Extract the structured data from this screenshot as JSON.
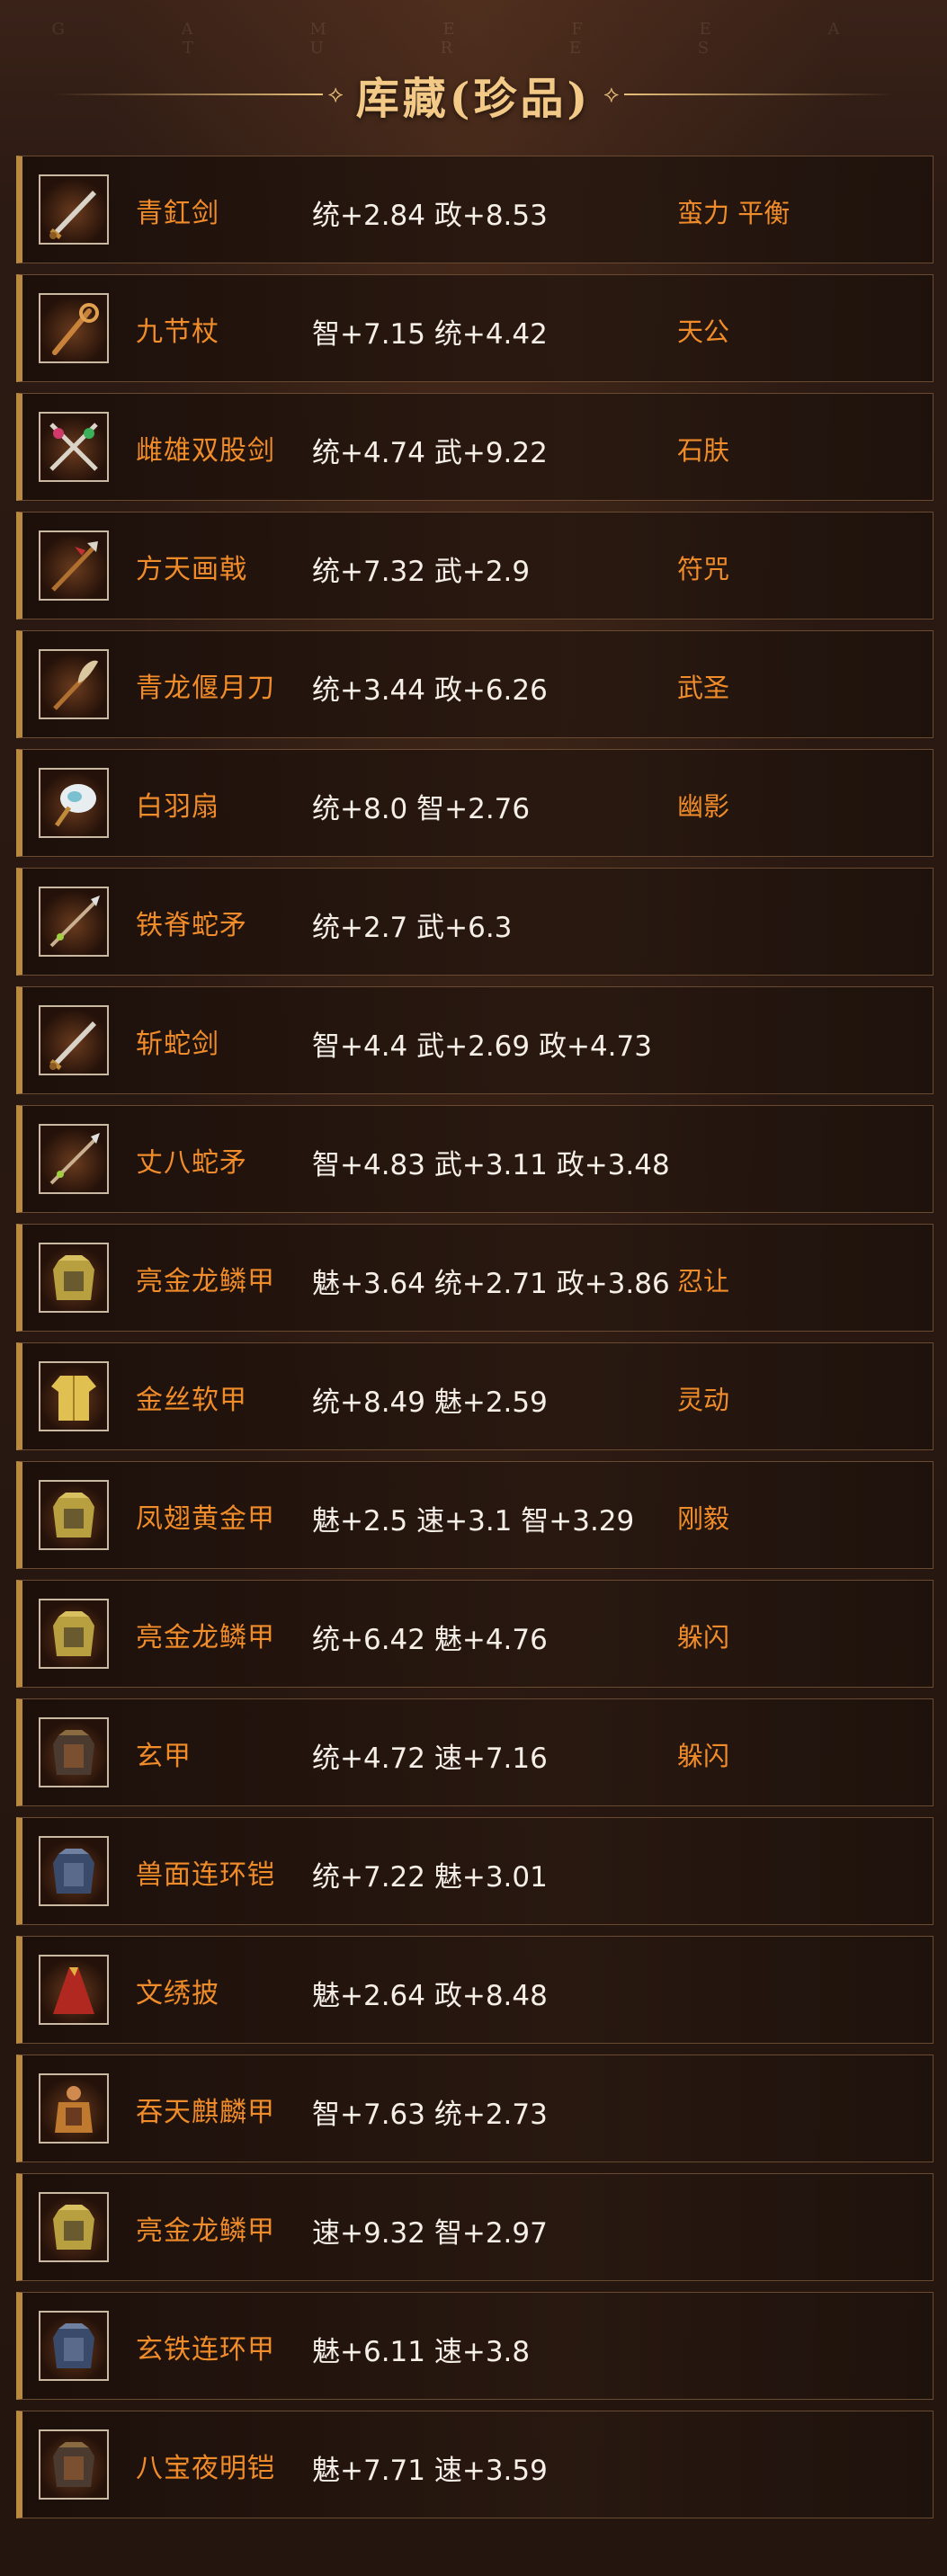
{
  "header": {
    "watermark": "G A M E   F E A T U R E S",
    "title": "库藏(珍品)",
    "ornament_left": "⟡",
    "ornament_right": "⟡"
  },
  "colors": {
    "name": "#f08c2a",
    "stats": "#f5efe8",
    "skill": "#f08c2a",
    "row_accent": "#b8893f",
    "title": "#f2c986"
  },
  "items": [
    {
      "name": "青釭剑",
      "stats": "统+2.84 政+8.53",
      "skill": "蛮力 平衡",
      "icon": "sword-icon"
    },
    {
      "name": "九节杖",
      "stats": "智+7.15 统+4.42",
      "skill": "天公",
      "icon": "staff-icon"
    },
    {
      "name": "雌雄双股剑",
      "stats": "统+4.74 武+9.22",
      "skill": "石肤",
      "icon": "twin-swords-icon"
    },
    {
      "name": "方天画戟",
      "stats": "统+7.32 武+2.9",
      "skill": "符咒",
      "icon": "halberd-icon"
    },
    {
      "name": "青龙偃月刀",
      "stats": "统+3.44 政+6.26",
      "skill": "武圣",
      "icon": "glaive-icon"
    },
    {
      "name": "白羽扇",
      "stats": "统+8.0 智+2.76",
      "skill": "幽影",
      "icon": "feather-fan-icon"
    },
    {
      "name": "铁脊蛇矛",
      "stats": "统+2.7 武+6.3",
      "skill": "",
      "icon": "spear-icon"
    },
    {
      "name": "斩蛇剑",
      "stats": "智+4.4 武+2.69 政+4.73",
      "skill": "",
      "icon": "sword-icon"
    },
    {
      "name": "丈八蛇矛",
      "stats": "智+4.83 武+3.11 政+3.48",
      "skill": "",
      "icon": "spear-icon"
    },
    {
      "name": "亮金龙鳞甲",
      "stats": "魅+3.64 统+2.71 政+3.86",
      "skill": "忍让",
      "icon": "armor-icon"
    },
    {
      "name": "金丝软甲",
      "stats": "统+8.49 魅+2.59",
      "skill": "灵动",
      "icon": "robe-icon"
    },
    {
      "name": "凤翅黄金甲",
      "stats": "魅+2.5 速+3.1 智+3.29",
      "skill": "刚毅",
      "icon": "armor-icon"
    },
    {
      "name": "亮金龙鳞甲",
      "stats": "统+6.42 魅+4.76",
      "skill": "躲闪",
      "icon": "armor-icon"
    },
    {
      "name": "玄甲",
      "stats": "统+4.72 速+7.16",
      "skill": "躲闪",
      "icon": "dark-armor-icon"
    },
    {
      "name": "兽面连环铠",
      "stats": "统+7.22 魅+3.01",
      "skill": "",
      "icon": "blue-armor-icon"
    },
    {
      "name": "文绣披",
      "stats": "魅+2.64 政+8.48",
      "skill": "",
      "icon": "cloak-icon"
    },
    {
      "name": "吞天麒麟甲",
      "stats": "智+7.63 统+2.73",
      "skill": "",
      "icon": "warrior-armor-icon"
    },
    {
      "name": "亮金龙鳞甲",
      "stats": "速+9.32 智+2.97",
      "skill": "",
      "icon": "armor-icon"
    },
    {
      "name": "玄铁连环甲",
      "stats": "魅+6.11 速+3.8",
      "skill": "",
      "icon": "blue-armor-icon"
    },
    {
      "name": "八宝夜明铠",
      "stats": "魅+7.71 速+3.59",
      "skill": "",
      "icon": "dark-armor-icon"
    }
  ]
}
